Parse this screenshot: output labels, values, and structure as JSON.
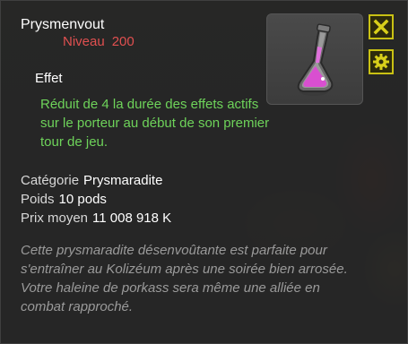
{
  "item": {
    "name": "Prysmenvout",
    "level_label": "Niveau",
    "level_value": "200"
  },
  "effect": {
    "title": "Effet",
    "text": "Réduit de 4 la durée des effets actifs sur le porteur au début de son premier tour de jeu."
  },
  "properties": [
    {
      "label": "Catégorie",
      "value": "Prysmaradite"
    },
    {
      "label": "Poids",
      "value": "10 pods"
    },
    {
      "label": "Prix moyen",
      "value": "11 008 918 K"
    }
  ],
  "description": "Cette prysmaradite désenvoûtante est parfaite pour s'entraîner au Kolizéum après une soirée bien arrosée. Votre haleine de porkass sera même une alliée en combat rapproché.",
  "buttons": {
    "close_icon": "close-x-icon",
    "settings_icon": "gear-icon"
  },
  "colors": {
    "level": "#e05050",
    "effect": "#6ed35a",
    "button_border": "#c9c114",
    "description": "#9a9a9a"
  }
}
